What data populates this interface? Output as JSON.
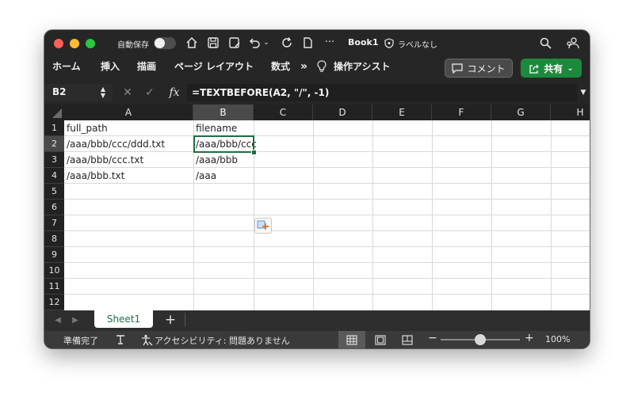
{
  "titlebar": {
    "autosave_label": "自動保存",
    "doc_title": "Book1",
    "label_text": "ラベルなし"
  },
  "ribbon": {
    "tabs": [
      "ホーム",
      "挿入",
      "描画",
      "ページ レイアウト",
      "数式",
      "操作アシスト"
    ],
    "comment_label": "コメント",
    "share_label": "共有"
  },
  "formula_bar": {
    "name_box": "B2",
    "fx": "fx",
    "formula": "=TEXTBEFORE(A2, \"/\", -1)"
  },
  "grid": {
    "columns": [
      "A",
      "B",
      "C",
      "D",
      "E",
      "F",
      "G",
      "H"
    ],
    "rows": [
      "1",
      "2",
      "3",
      "4",
      "5",
      "6",
      "7",
      "8",
      "9",
      "10",
      "11",
      "12"
    ],
    "cells": {
      "A1": "full_path",
      "B1": "filename",
      "A2": "/aaa/bbb/ccc/ddd.txt",
      "B2": "/aaa/bbb/ccc",
      "A3": "/aaa/bbb/ccc.txt",
      "B3": "/aaa/bbb",
      "A4": "/aaa/bbb.txt",
      "B4": "/aaa"
    },
    "selected_cell": "B2"
  },
  "sheets": {
    "tabs": [
      "Sheet1"
    ],
    "add_label": "+"
  },
  "statusbar": {
    "ready": "準備完了",
    "accessibility": "アクセシビリティ: 問題ありません",
    "zoom": "100%",
    "zoom_level": 0.5
  },
  "colors": {
    "accent": "#1e6e42",
    "share": "#1c8a3c",
    "close": "#fe5f57",
    "minimize": "#febc2e",
    "maximize": "#28c840"
  }
}
